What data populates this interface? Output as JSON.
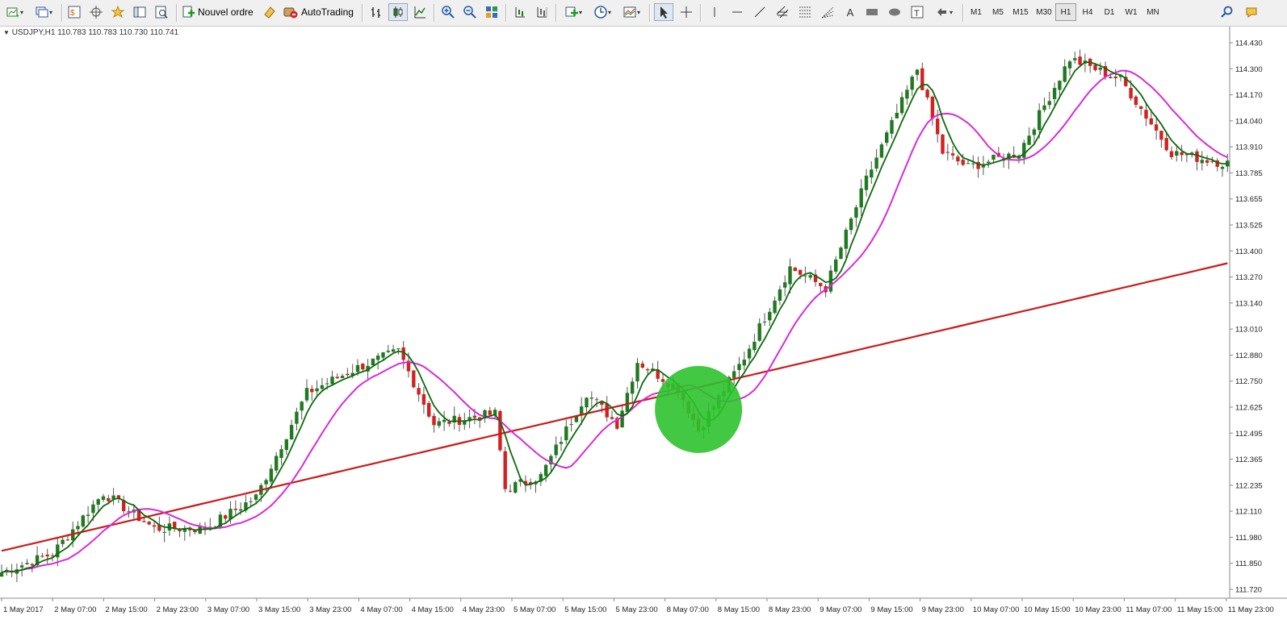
{
  "toolbar": {
    "new_order_label": "Nouvel ordre",
    "autotrading_label": "AutoTrading",
    "timeframes": [
      "M1",
      "M5",
      "M15",
      "M30",
      "H1",
      "H4",
      "D1",
      "W1",
      "MN"
    ],
    "active_timeframe": "H1"
  },
  "chart": {
    "symbol_info": "USDJPY,H1  110.783 110.783 110.730 110.741",
    "price_axis_labels": [
      "114.430",
      "114.300",
      "114.170",
      "114.040",
      "113.910",
      "113.785",
      "113.655",
      "113.525",
      "113.400",
      "113.270",
      "113.140",
      "113.010",
      "112.880",
      "112.750",
      "112.625",
      "112.495",
      "112.365",
      "112.235",
      "112.110",
      "111.980",
      "111.850",
      "111.720"
    ],
    "time_axis_labels": [
      "1 May 2017",
      "2 May 07:00",
      "2 May 15:00",
      "2 May 23:00",
      "3 May 07:00",
      "3 May 15:00",
      "3 May 23:00",
      "4 May 07:00",
      "4 May 15:00",
      "4 May 23:00",
      "5 May 07:00",
      "5 May 15:00",
      "5 May 23:00",
      "8 May 07:00",
      "8 May 15:00",
      "8 May 23:00",
      "9 May 07:00",
      "9 May 15:00",
      "9 May 23:00",
      "10 May 07:00",
      "10 May 15:00",
      "10 May 23:00",
      "11 May 07:00",
      "11 May 15:00",
      "11 May 23:00"
    ],
    "colors": {
      "bull": "#1f7a1f",
      "bear": "#d42020",
      "wick": "#555555",
      "ma_fast": "#0b6b0b",
      "ma_mid": "#d82ad8",
      "ma_slow": "#cc1a1a",
      "highlight": "#2ec22e"
    }
  },
  "chart_data": {
    "type": "candlestick",
    "symbol": "USDJPY",
    "timeframe": "H1",
    "y_range": [
      111.72,
      114.43
    ],
    "close_path_anchors": [
      {
        "bar": 0,
        "price": 111.84
      },
      {
        "bar": 10,
        "price": 111.93
      },
      {
        "bar": 20,
        "price": 112.22
      },
      {
        "bar": 30,
        "price": 112.05
      },
      {
        "bar": 40,
        "price": 112.05
      },
      {
        "bar": 50,
        "price": 112.2
      },
      {
        "bar": 60,
        "price": 112.7
      },
      {
        "bar": 70,
        "price": 112.82
      },
      {
        "bar": 78,
        "price": 112.9
      },
      {
        "bar": 85,
        "price": 112.55
      },
      {
        "bar": 97,
        "price": 112.6
      },
      {
        "bar": 99,
        "price": 112.24
      },
      {
        "bar": 106,
        "price": 112.3
      },
      {
        "bar": 115,
        "price": 112.7
      },
      {
        "bar": 121,
        "price": 112.55
      },
      {
        "bar": 125,
        "price": 112.85
      },
      {
        "bar": 133,
        "price": 112.72
      },
      {
        "bar": 137,
        "price": 112.52
      },
      {
        "bar": 146,
        "price": 112.87
      },
      {
        "bar": 155,
        "price": 113.3
      },
      {
        "bar": 162,
        "price": 113.2
      },
      {
        "bar": 170,
        "price": 113.72
      },
      {
        "bar": 180,
        "price": 114.25
      },
      {
        "bar": 185,
        "price": 113.85
      },
      {
        "bar": 190,
        "price": 113.78
      },
      {
        "bar": 200,
        "price": 113.85
      },
      {
        "bar": 210,
        "price": 114.3
      },
      {
        "bar": 220,
        "price": 114.2
      },
      {
        "bar": 230,
        "price": 113.85
      },
      {
        "bar": 240,
        "price": 113.8
      }
    ],
    "moving_averages": [
      {
        "name": "ma_fast",
        "start": 111.83,
        "end": 113.84
      },
      {
        "name": "ma_mid",
        "start": 111.75,
        "end": 113.93
      },
      {
        "name": "ma_slow",
        "start": 111.7,
        "end": 113.32
      }
    ],
    "highlight": {
      "shape": "circle",
      "bar": 137,
      "price": 112.62
    }
  }
}
